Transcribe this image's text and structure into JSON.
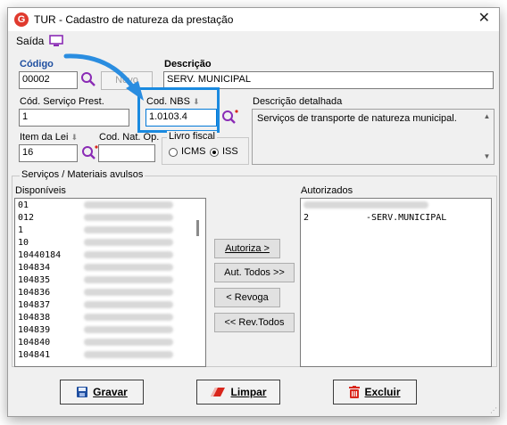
{
  "window": {
    "title": "TUR - Cadastro de natureza da prestação",
    "logo_letter": "G"
  },
  "menu": {
    "saida": "Saída"
  },
  "fields": {
    "codigo_label": "Código",
    "codigo_value": "00002",
    "descricao_label": "Descrição",
    "descricao_value": "SERV. MUNICIPAL",
    "cod_servico_label": "Cód. Serviço Prest.",
    "cod_servico_value": "1",
    "cod_nbs_label": "Cod. NBS",
    "cod_nbs_value": "1.0103.4",
    "descricao_detalhada_label": "Descrição detalhada",
    "descricao_detalhada_value": "Serviços de transporte de natureza municipal.",
    "item_lei_label": "Item da Lei",
    "item_lei_value": "16",
    "cod_nat_op_label": "Cod. Nat. Op.",
    "cod_nat_op_value": "",
    "livro_fiscal_label": "Livro fiscal",
    "livro_options": [
      "ICMS",
      "ISS"
    ],
    "livro_selected": "ISS",
    "novo_button": "Novo"
  },
  "servicos_group": {
    "legend": "Serviços  /  Materiais avulsos",
    "disponiveis_label": "Disponíveis",
    "autorizados_label": "Autorizados",
    "disponiveis_codes": [
      "01",
      "012",
      "1",
      "10",
      "10440184",
      "104834",
      "104835",
      "104836",
      "104837",
      "104838",
      "104839",
      "104840",
      "104841"
    ],
    "autorizados_items": [
      {
        "code": "2",
        "name": "-SERV.MUNICIPAL"
      }
    ]
  },
  "transfer_buttons": {
    "autoriza": "Autoriza >",
    "aut_todos": "Aut. Todos >>",
    "revoga": "< Revoga",
    "rev_todos": "<< Rev.Todos"
  },
  "actions": {
    "gravar": "Gravar",
    "limpar": "Limpar",
    "excluir": "Excluir"
  },
  "colors": {
    "highlight": "#1a8ae0",
    "accent_blue": "#1f4fa0",
    "danger_red": "#d9261c",
    "search_purple": "#8a2bb5"
  }
}
